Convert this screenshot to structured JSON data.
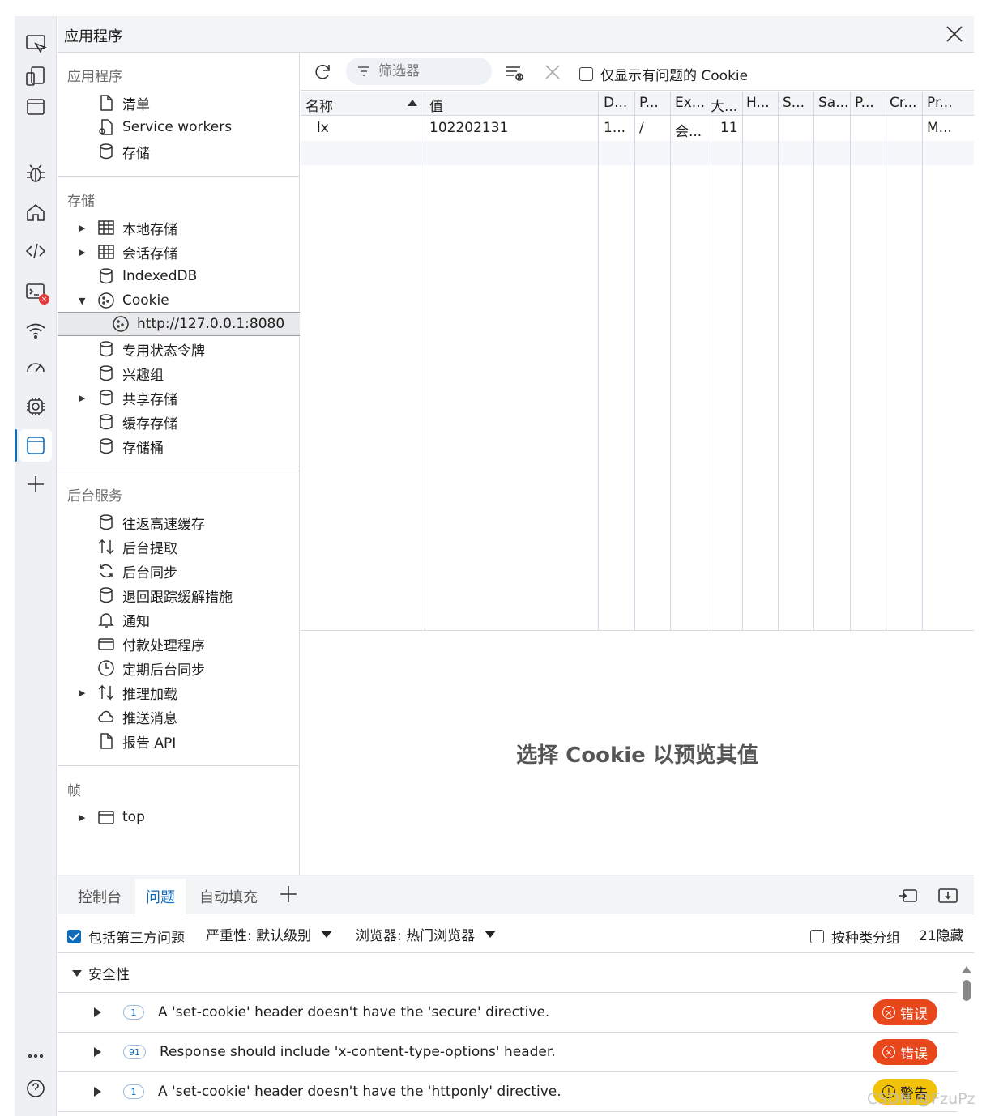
{
  "window": {
    "title": "应用程序"
  },
  "sidebar": {
    "section_app": "应用程序",
    "app_items": [
      "清单",
      "Service workers",
      "存储"
    ],
    "section_storage": "存储",
    "storage_items": [
      "本地存储",
      "会话存储",
      "IndexedDB",
      "Cookie",
      "http://127.0.0.1:8080",
      "专用状态令牌",
      "兴趣组",
      "共享存储",
      "缓存存储",
      "存储桶"
    ],
    "section_bg": "后台服务",
    "bg_items": [
      "往返高速缓存",
      "后台提取",
      "后台同步",
      "退回跟踪缓解措施",
      "通知",
      "付款处理程序",
      "定期后台同步",
      "推理加载",
      "推送消息",
      "报告 API"
    ],
    "section_frames": "帧",
    "frame_items": [
      "top"
    ]
  },
  "toolbar": {
    "filter_placeholder": "筛选器",
    "only_issues_label": "仅显示有问题的 Cookie"
  },
  "cookie_table": {
    "headers": [
      "名称",
      "值",
      "D...",
      "P...",
      "Ex...",
      "大...",
      "H...",
      "S...",
      "Sa...",
      "P...",
      "Cr...",
      "Pr..."
    ],
    "rows": [
      [
        "lx",
        "102202131",
        "1...",
        "/",
        "会...",
        "11",
        "",
        "",
        "",
        "",
        "",
        "M..."
      ]
    ]
  },
  "preview": {
    "empty_text": "选择 Cookie 以预览其值"
  },
  "drawer": {
    "tabs": [
      "控制台",
      "问题",
      "自动填充"
    ],
    "active_tab": "问题",
    "include_third_party": "包括第三方问题",
    "severity": "严重性: 默认级别",
    "browser": "浏览器:  热门浏览器",
    "group_by_kind": "按种类分组",
    "hidden_count": "21隐藏",
    "category": "安全性",
    "issues": [
      {
        "count": "1",
        "text": "A 'set-cookie' header doesn't have the 'secure' directive.",
        "level": "错误",
        "kind": "error"
      },
      {
        "count": "91",
        "text": "Response should include 'x-content-type-options' header.",
        "level": "错误",
        "kind": "error"
      },
      {
        "count": "1",
        "text": "A 'set-cookie' header doesn't have the 'httponly' directive.",
        "level": "警告",
        "kind": "warning"
      }
    ]
  },
  "overlay": {
    "watermark": "CSDN @FzuPz"
  },
  "colors": {
    "accent": "#0f6cbd",
    "error": "#e8471c",
    "warning": "#f2c20b"
  },
  "icons": [
    "inspect-icon",
    "device-icon",
    "browser-window-icon",
    "bug-icon",
    "home-icon",
    "code-icon",
    "console-icon",
    "wifi-icon",
    "performance-icon",
    "cpu-icon",
    "application-icon",
    "add-icon",
    "more-icon",
    "help-icon"
  ]
}
